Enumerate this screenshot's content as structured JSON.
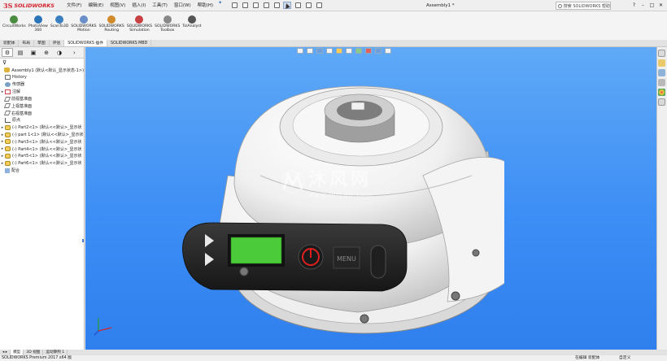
{
  "app": {
    "brand": "SOLIDWORKS",
    "brand_mark": "3S",
    "document_title": "Assembly1 *"
  },
  "menu": {
    "items": [
      "文件(F)",
      "编辑(E)",
      "视图(V)",
      "插入(I)",
      "工具(T)",
      "窗口(W)",
      "帮助(H)"
    ]
  },
  "search": {
    "placeholder": "搜索 SOLIDWORKS 帮助"
  },
  "window_controls": {
    "help": "?",
    "minimize": "–",
    "restore": "□",
    "close": "✕"
  },
  "ribbon": {
    "items": [
      {
        "label": "CircuitWorks",
        "color": "#4a8c3f"
      },
      {
        "label": "PhotoView\n360",
        "color": "#2c74b8"
      },
      {
        "label": "ScanTo3D",
        "color": "#3a7fc0"
      },
      {
        "label": "SOLIDWORKS\nMotion",
        "color": "#6a8fc8"
      },
      {
        "label": "SOLIDWORKS\nRouting",
        "color": "#d08a2a"
      },
      {
        "label": "SOLIDWORKS\nSimulation",
        "color": "#c84040"
      },
      {
        "label": "SOLIDWORKS\nToolbox",
        "color": "#888888"
      },
      {
        "label": "TolAnalyst",
        "color": "#555555"
      }
    ]
  },
  "command_tabs": [
    "装配体",
    "布局",
    "草图",
    "评估",
    "SOLIDWORKS 插件",
    "SOLIDWORKS MBD"
  ],
  "feature_tree": {
    "filter_icon": "funnel-icon",
    "nodes": [
      {
        "label": "Assembly1 (默认<默认_显示状态-1>)",
        "icon": "asm",
        "expand": ""
      },
      {
        "label": "History",
        "icon": "hist",
        "expand": ""
      },
      {
        "label": "传感器",
        "icon": "sensor",
        "expand": ""
      },
      {
        "label": "注解",
        "icon": "note",
        "expand": "▸"
      },
      {
        "label": "前视基准面",
        "icon": "plane",
        "expand": ""
      },
      {
        "label": "上视基准面",
        "icon": "plane",
        "expand": ""
      },
      {
        "label": "右视基准面",
        "icon": "plane",
        "expand": ""
      },
      {
        "label": "原点",
        "icon": "origin",
        "expand": ""
      },
      {
        "label": "(-) Part2<1> (默认<<默认>_显示状",
        "icon": "part",
        "expand": "▸"
      },
      {
        "label": "(-) part 1<1> (默认<<默认>_显示状",
        "icon": "part",
        "expand": "▸"
      },
      {
        "label": "(-) Part3<1> (默认<<默认>_显示状",
        "icon": "part",
        "expand": "▸"
      },
      {
        "label": "(-) Part4<1> (默认<<默认>_显示状",
        "icon": "part",
        "expand": "▸"
      },
      {
        "label": "(-) Part5<1> (默认<<默认>_显示状",
        "icon": "part",
        "expand": "▸"
      },
      {
        "label": "(-) Part6<1> (默认<<默认>_显示状",
        "icon": "part",
        "expand": "▸"
      },
      {
        "label": "配合",
        "icon": "mate",
        "expand": ""
      }
    ]
  },
  "watermark": {
    "cn": "沐风网",
    "url": "www.mfcad.com"
  },
  "model": {
    "display_label": "MENU"
  },
  "bottom_tabs": [
    "模型",
    "3D 视图",
    "运动算例 1"
  ],
  "status": {
    "left": "SOLIDWORKS Premium 2017 x64 版",
    "mid": "在编辑 装配体",
    "right": "自定义"
  },
  "colors": {
    "viewport_top": "#5fa9f7",
    "viewport_bottom": "#2f7fee",
    "lcd": "#4ccb3a",
    "power_ring": "#e02020"
  }
}
